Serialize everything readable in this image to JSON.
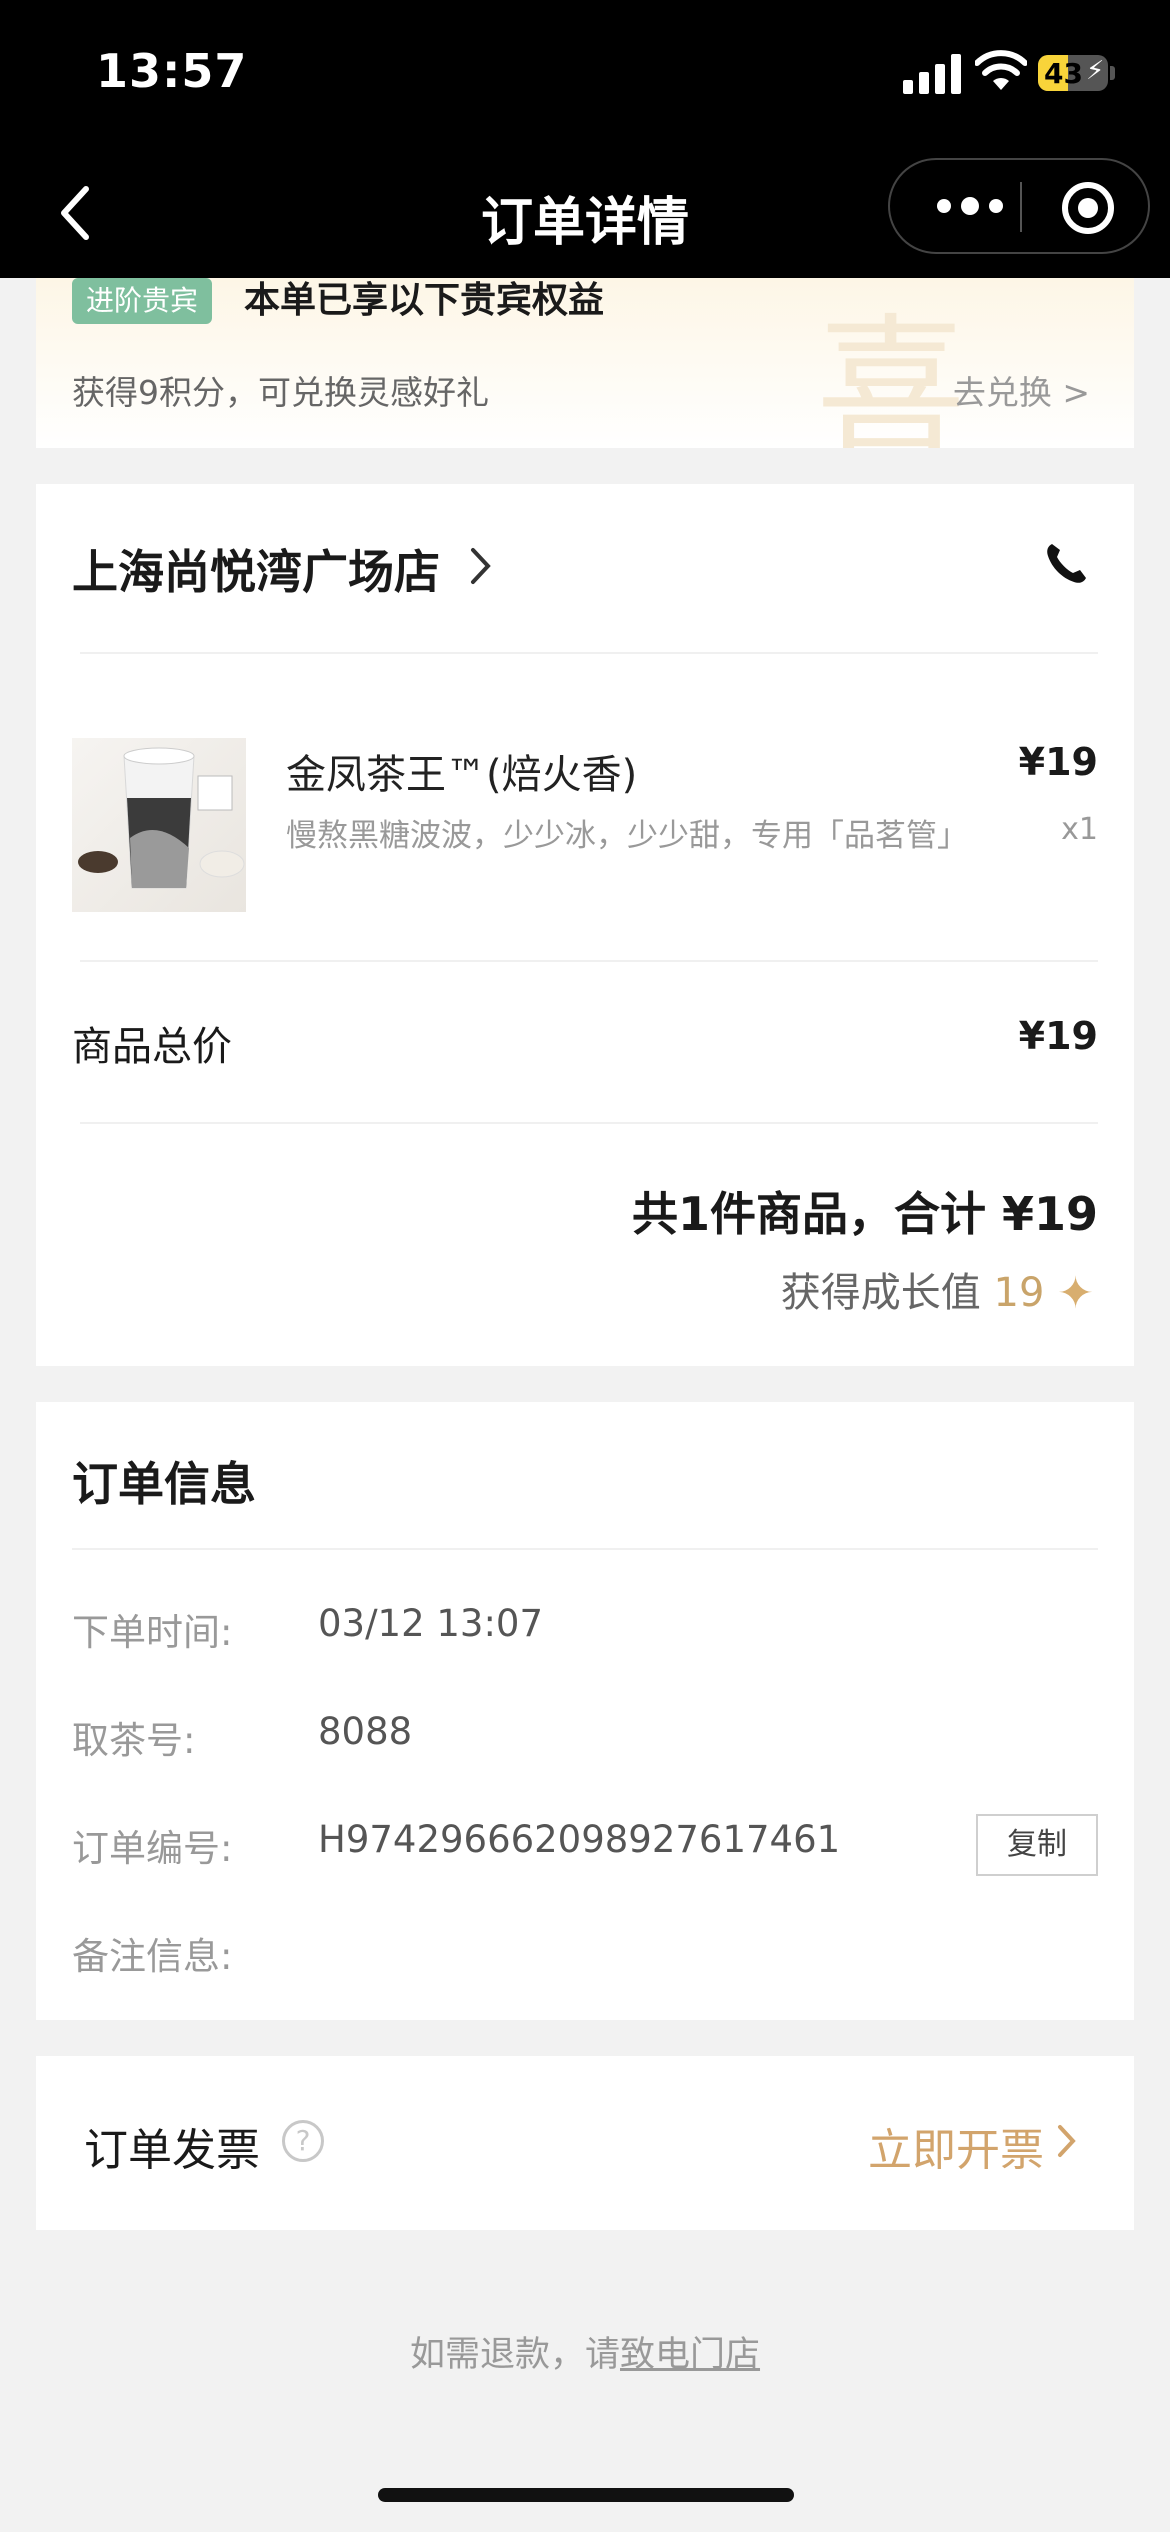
{
  "status_bar": {
    "time": "13:57",
    "battery": "43"
  },
  "nav": {
    "title": "订单详情"
  },
  "vip": {
    "badge": "进阶贵宾",
    "title": "本单已享以下贵宾权益",
    "watermark": "喜",
    "points_text": "获得9积分，可兑换灵感好礼",
    "redeem_label": "去兑换 >"
  },
  "store": {
    "name": "上海尚悦湾广场店"
  },
  "product": {
    "name": "金凤茶王™(焙火香)",
    "spec": "慢熬黑糖波波，少少冰，少少甜，专用「品茗管」",
    "price": "¥19",
    "qty": "x1"
  },
  "summary": {
    "subtotal_label": "商品总价",
    "subtotal_value": "¥19",
    "total_text": "共1件商品，合计 ¥19",
    "growth_label": "获得成长值",
    "growth_value": "19"
  },
  "order_info": {
    "title": "订单信息",
    "rows": [
      {
        "label": "下单时间:",
        "value": "03/12 13:07"
      },
      {
        "label": "取茶号:",
        "value": "8088"
      },
      {
        "label": "订单编号:",
        "value": "H9742966620989276174​61"
      },
      {
        "label": "备注信息:",
        "value": ""
      }
    ],
    "copy_label": "复制"
  },
  "invoice": {
    "label": "订单发票",
    "action": "立即开票"
  },
  "refund": {
    "prefix": "如需退款，请",
    "link": "致电门店"
  },
  "colors": {
    "accent_gold": "#d2a46c",
    "vip_badge": "#7fbf9e",
    "nav_bg": "#000000"
  }
}
